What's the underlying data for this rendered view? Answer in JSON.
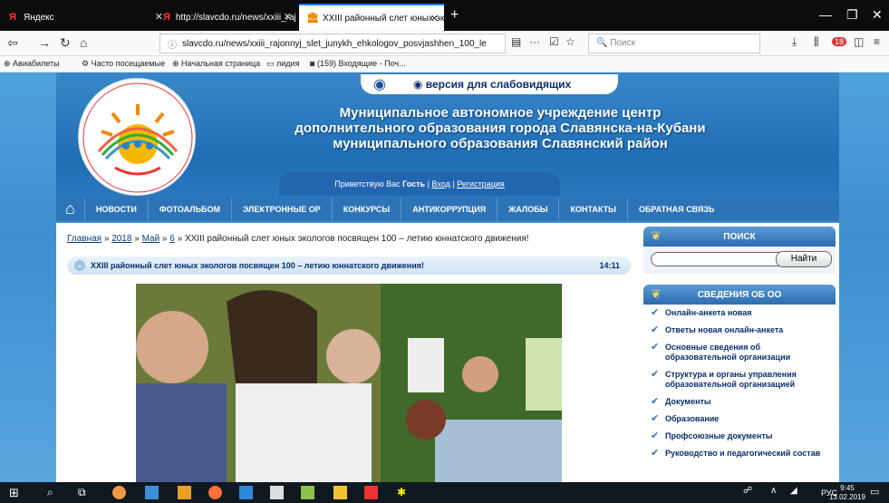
{
  "browser": {
    "tabs": [
      {
        "label": "Яндекс",
        "favicon": "Я"
      },
      {
        "label": "http://slavcdo.ru/news/xxiii_raj",
        "favicon": "Я"
      },
      {
        "label": "XXIII районный слет юных эко",
        "favicon": "🏛"
      }
    ],
    "url": "slavcdo.ru/news/xxiii_rajonnyj_slet_junykh_ehkologov_posvjashhen_100_le",
    "search_placeholder": "Поиск",
    "addon_badge": "18",
    "bookmarks": [
      "Авиабилеты",
      "Часто посещаемые",
      "Начальная страница",
      "лидия",
      "(159) Входящие - Поч..."
    ]
  },
  "site": {
    "vision_label": "версия для слабовидящих",
    "org_line1": "Муниципальное автономное учреждение центр",
    "org_line2": "дополнительного образования города Славянска-на-Кубани",
    "org_line3": "муниципального образования Славянский район",
    "greet_prefix": "Приветствую Вас ",
    "greet_user": "Гость",
    "login": "Вход",
    "register": "Регистрация",
    "sep": " | ",
    "menu": [
      "НОВОСТИ",
      "ФОТОАЛЬБОМ",
      "ЭЛЕКТРОННЫЕ ОР",
      "КОНКУРСЫ",
      "АНТИКОРРУПЦИЯ",
      "ЖАЛОБЫ",
      "КОНТАКТЫ",
      "ОБРАТНАЯ СВЯЗЬ"
    ],
    "crumb": {
      "home": "Главная",
      "year": "2018",
      "month": "Май",
      "day": "6",
      "arrow": " » ",
      "title": "XXIII районный слет юных экологов посвящен 100 – летию юннатского движения!"
    },
    "article": {
      "title": "XXIII районный слет юных экологов посвящен 100 – летию юннатского движения!",
      "time": "14:11"
    },
    "sidebar": {
      "search_title": "ПОИСК",
      "search_button": "Найти",
      "info_title": "СВЕДЕНИЯ ОБ ОО",
      "items": [
        "Онлайн-анкета новая",
        "Ответы новая онлайн-анкета",
        "Основные сведения об образовательной организации",
        "Структура и органы управления образовательной организацией",
        "Документы",
        "Образование",
        "Профсоюзные документы",
        "Руководство и педагогический состав"
      ]
    }
  },
  "taskbar": {
    "lang": "РУС",
    "time": "9:45",
    "date": "13.02.2019"
  }
}
